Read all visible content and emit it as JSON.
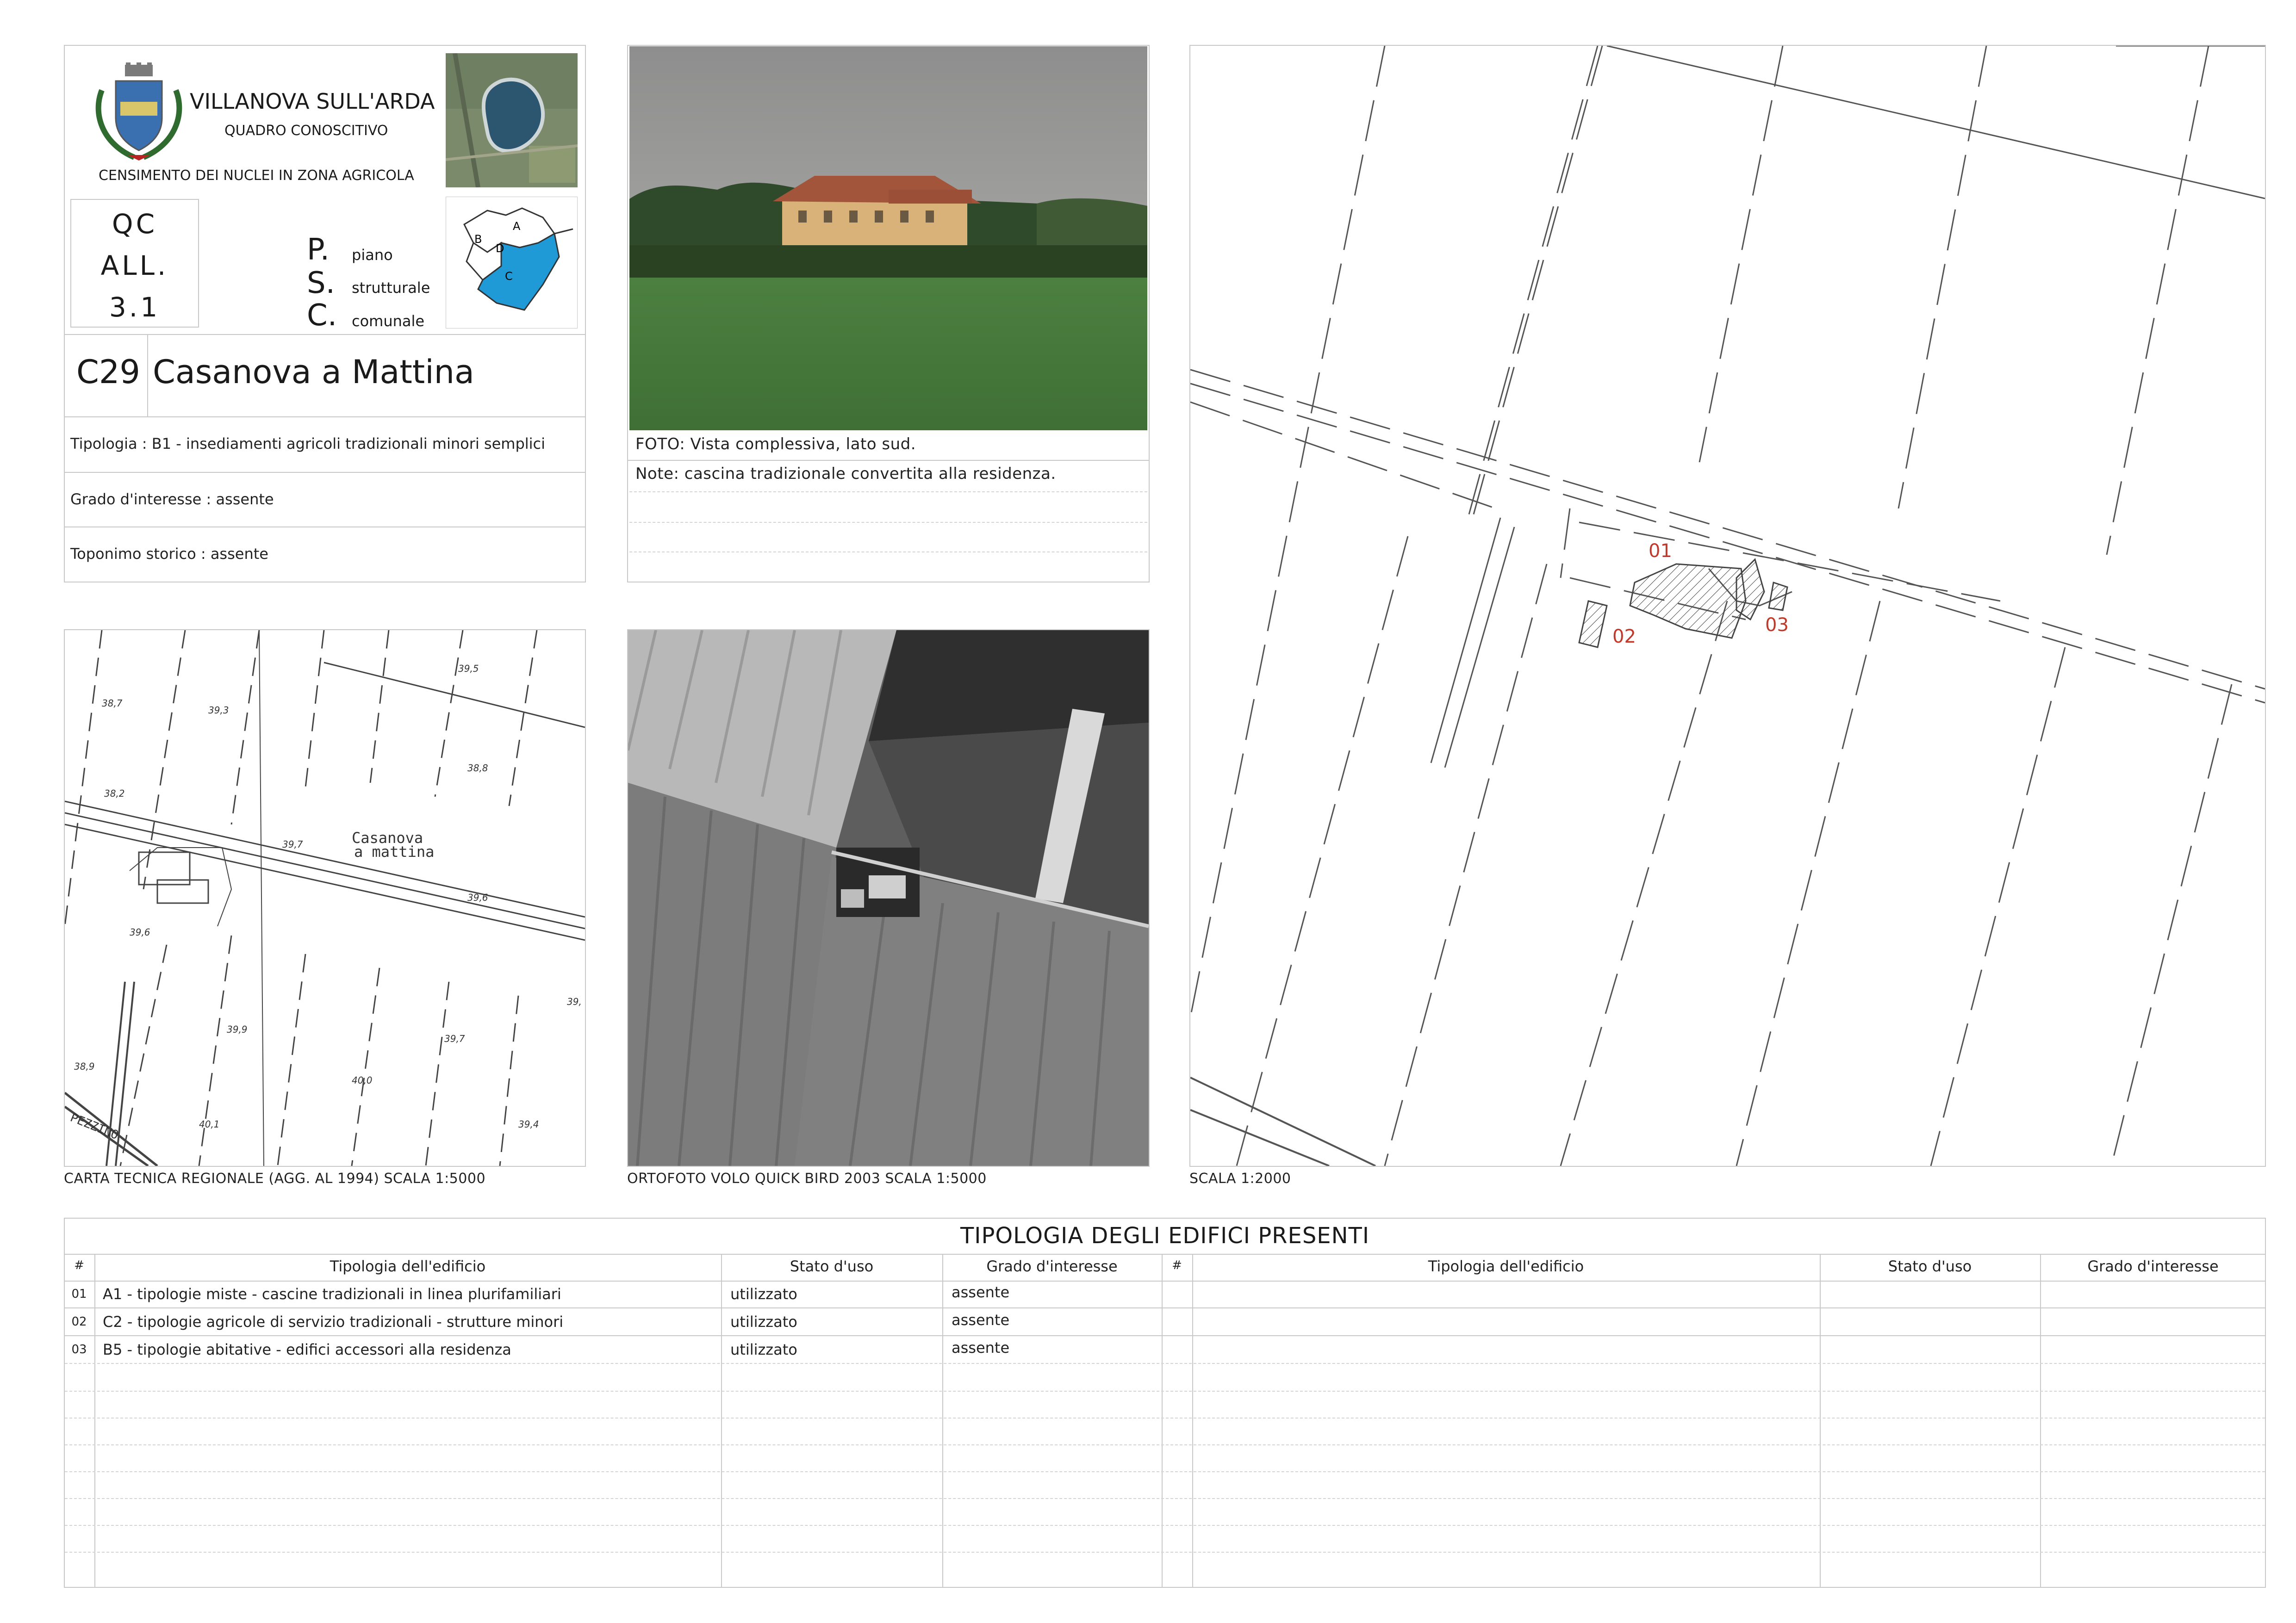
{
  "header": {
    "comune": "VILLANOVA SULL'ARDA",
    "subtitle": "QUADRO CONOSCITIVO",
    "census": "CENSIMENTO DEI NUCLEI IN ZONA AGRICOLA",
    "qc_lines": [
      "QC",
      "ALL.",
      "3.1"
    ],
    "psc_letters": [
      "P.",
      "S.",
      "C."
    ],
    "psc_words": [
      "piano",
      "strutturale",
      "comunale"
    ],
    "zone_labels": [
      "A",
      "B",
      "C",
      "D"
    ]
  },
  "record": {
    "code": "C29",
    "name": "Casanova a Mattina",
    "tipologia": "Tipologia : B1 - insediamenti agricoli tradizionali minori semplici",
    "grado": "Grado d'interesse : assente",
    "toponimo": "Toponimo storico : assente"
  },
  "photo": {
    "caption": "FOTO: Vista complessiva, lato sud.",
    "note": "Note: cascina tradizionale convertita alla residenza."
  },
  "maps": {
    "ctr_caption": "CARTA TECNICA REGIONALE (AGG. AL 1994) SCALA 1:5000",
    "ortho_caption": "ORTOFOTO VOLO QUICK BIRD 2003 SCALA 1:5000",
    "plan_caption": "SCALA 1:2000",
    "ctr_place": [
      "Casanova",
      "a mattina"
    ],
    "ctr_road": "PEZZINO",
    "ctr_elevations": [
      "38,7",
      "39,3",
      "39,5",
      "38,2",
      "38,8",
      "39,7",
      "39,6",
      "39,6",
      "39,9",
      "39,7",
      "40,0",
      "38,9",
      "40,1",
      "39,4",
      "39,"
    ],
    "building_ids": [
      "01",
      "02",
      "03"
    ]
  },
  "colors": {
    "accent_red": "#c0392b",
    "zone_blue": "#1f9ad6",
    "border": "#c8c8c8"
  },
  "table": {
    "title": "TIPOLOGIA DEGLI EDIFICI PRESENTI",
    "headers": {
      "num": "#",
      "tipologia": "Tipologia dell'edificio",
      "stato": "Stato d'uso",
      "grado": "Grado d'interesse"
    },
    "rows": [
      {
        "num": "01",
        "tipologia": "A1 - tipologie miste - cascine tradizionali in linea plurifamiliari",
        "stato": "utilizzato",
        "grado": "assente"
      },
      {
        "num": "02",
        "tipologia": "C2 - tipologie agricole di servizio tradizionali - strutture minori",
        "stato": "utilizzato",
        "grado": "assente"
      },
      {
        "num": "03",
        "tipologia": "B5 - tipologie abitative - edifici accessori alla residenza",
        "stato": "utilizzato",
        "grado": "assente"
      }
    ]
  }
}
